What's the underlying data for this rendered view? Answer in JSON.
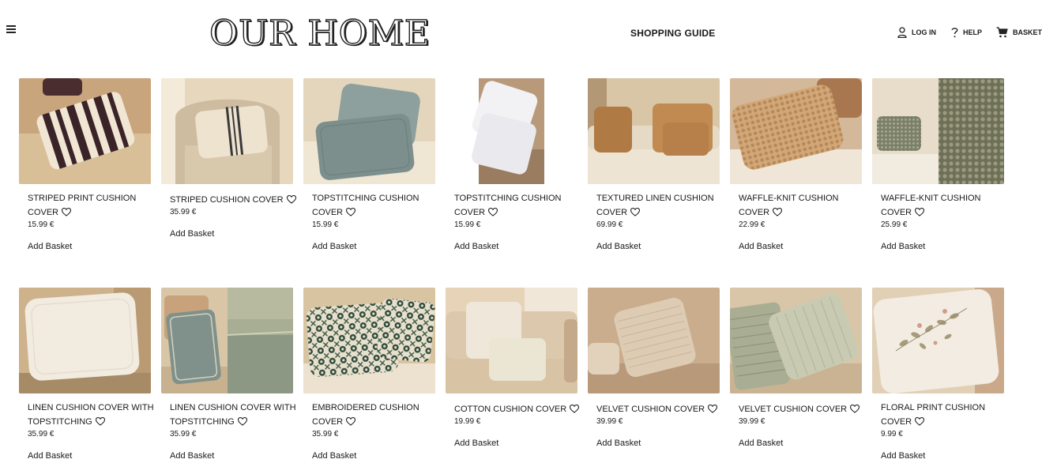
{
  "header": {
    "logo": "OUR HOME",
    "shopping_guide": "SHOPPING GUIDE",
    "login": "LOG IN",
    "help": "HELP",
    "basket": "BASKET"
  },
  "products": [
    {
      "name": "STRIPED PRINT CUSHION COVER",
      "price": "15.99 €",
      "cta": "Add Basket"
    },
    {
      "name": "STRIPED CUSHION COVER",
      "price": "35.99 €",
      "cta": "Add Basket"
    },
    {
      "name": "TOPSTITCHING CUSHION COVER",
      "price": "15.99 €",
      "cta": "Add Basket"
    },
    {
      "name": "TOPSTITCHING CUSHION COVER",
      "price": "15.99 €",
      "cta": "Add Basket"
    },
    {
      "name": "TEXTURED LINEN CUSHION COVER",
      "price": "69.99 €",
      "cta": "Add Basket"
    },
    {
      "name": "WAFFLE-KNIT CUSHION COVER",
      "price": "22.99 €",
      "cta": "Add Basket"
    },
    {
      "name": "WAFFLE-KNIT CUSHION COVER",
      "price": "25.99 €",
      "cta": "Add Basket"
    },
    {
      "name": "LINEN CUSHION COVER WITH TOPSTITCHING",
      "price": "35.99 €",
      "cta": "Add Basket"
    },
    {
      "name": "LINEN CUSHION COVER WITH TOPSTITCHING",
      "price": "35.99 €",
      "cta": "Add Basket"
    },
    {
      "name": "EMBROIDERED CUSHION COVER",
      "price": "35.99 €",
      "cta": "Add Basket"
    },
    {
      "name": "COTTON CUSHION COVER",
      "price": "19.99 €",
      "cta": "Add Basket"
    },
    {
      "name": "VELVET CUSHION COVER",
      "price": "39.99 €",
      "cta": "Add Basket"
    },
    {
      "name": "VELVET CUSHION COVER",
      "price": "39.99 €",
      "cta": "Add Basket"
    },
    {
      "name": "FLORAL PRINT CUSHION COVER",
      "price": "9.99 €",
      "cta": "Add Basket"
    }
  ],
  "icons": {
    "menu": "hamburger-icon",
    "login": "user-icon",
    "help": "question-icon",
    "basket": "cart-icon",
    "favorite": "heart-icon"
  },
  "colors": {
    "text": "#1a1a1a",
    "background": "#ffffff",
    "photo_beige": "#d8c3a2"
  }
}
